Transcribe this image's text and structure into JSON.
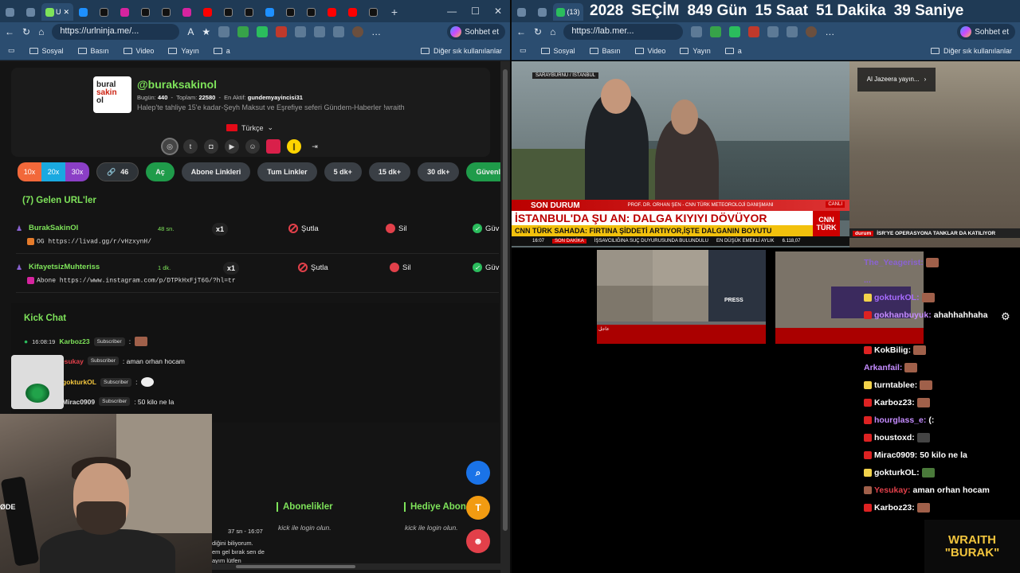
{
  "left_browser": {
    "active_tab": "U",
    "url": "https://urlninja.me/...",
    "sohbet": "Sohbet et",
    "bookmarks": [
      "Sosyal",
      "Basın",
      "Video",
      "Yayın",
      "a"
    ],
    "other_bookmarks": "Diğer sık kullanılanlar"
  },
  "profile": {
    "logo_lines": [
      "bural",
      "sakin",
      "ol"
    ],
    "username": "@buraksakinol",
    "today_label": "Bugün:",
    "today_value": "440",
    "total_label": "Toplam:",
    "total_value": "22580",
    "active_label": "En Aktif:",
    "active_value": "gundemyayincisi31",
    "description": "Halep'te tahliye 15'e kadar-Şeyh Maksut ve Eşrefiye seferi Gündem-Haberler !wraith",
    "language": "Türkçe"
  },
  "toolbar": {
    "speeds": [
      "10x",
      "20x",
      "30x"
    ],
    "link_count": "46",
    "ac": "Aç",
    "abone_links": "Abone Linkleri",
    "all_links": "Tum Linkler",
    "dk5": "5 dk+",
    "dk15": "15 dk+",
    "dk30": "30 dk+",
    "safe_open": "Güvenlileri Aç",
    "more": "G"
  },
  "incoming": {
    "title": "(7) Gelen URL'ler",
    "rows": [
      {
        "user": "BurakSakinOl",
        "time": "48 sn.",
        "link": "OG https://livad.gg/r/vHzxynH/",
        "count": "x1",
        "ban": "Şutla",
        "del": "Sil",
        "safe": "Güv"
      },
      {
        "user": "KifayetsizMuhteriss",
        "time": "1 dk.",
        "link": "Abone https://www.instagram.com/p/DTPkHxFjT6G/?hl=tr",
        "count": "x1",
        "ban": "Şutla",
        "del": "Sil",
        "safe": "Güv"
      }
    ]
  },
  "kick_chat": {
    "title": "Kick Chat",
    "lines": [
      {
        "time": "16:08:19",
        "user": "Karboz23",
        "badge": "Subscriber",
        "text": ":"
      },
      {
        "time": "",
        "user": "esukay",
        "badge": "Subscriber",
        "text": ": aman orhan hocam"
      },
      {
        "time": "",
        "user": "gokturkOL",
        "badge": "Subscriber",
        "text": ":"
      },
      {
        "time": "",
        "user": "Mirac0909",
        "badge": "Subscriber",
        "text": ": 50 kilo ne la"
      }
    ]
  },
  "webcam_label": "ØDE",
  "bottom": {
    "aboneler": "Abonelikler",
    "hediye": "Hediye Abon",
    "login1": "kick ile login olun.",
    "login2": "kick ile login olun.",
    "chat_time": "37 sn - 16:07",
    "chat_lines": [
      "diğini biliyorum.",
      "em gel bırak sen de",
      "ayım lütfen"
    ],
    "fab_t": "T"
  },
  "right_browser": {
    "tab_count": "(13)",
    "url": "https://lab.mer...",
    "sohbet": "Sohbet et",
    "bookmarks": [
      "Sosyal",
      "Basın",
      "Video",
      "Yayın",
      "a"
    ],
    "other_bookmarks": "Diğer sık kullanılanlar"
  },
  "countdown": {
    "year": "2028",
    "label": "SEÇİM",
    "days": "849 Gün",
    "hours": "15 Saat",
    "minutes": "51 Dakika",
    "seconds": "39 Saniye"
  },
  "cnn": {
    "location": "SARAYBURNU / İSTANBUL",
    "son_durum": "SON DURUM",
    "guest": "PROF. DR. ORHAN ŞEN - CNN TÜRK METEOROLOJİ DANIŞMANI",
    "live": "CANLI",
    "headline": "İSTANBUL'DA ŞU AN: DALGA KIYIYI DÖVÜYOR",
    "sub": "CNN TÜRK SAHADA: FIRTINA ŞİDDETİ ARTIYOR,İŞTE DALGANIN BOYUTU",
    "logo": [
      "CNN",
      "TÜRK"
    ],
    "ticker_time": "16:07",
    "ticker_tag": "SON DAKİKA",
    "ticker_text": "İŞSAVCILIĞINA SUÇ DUYURUSUNDA BULUNDULU",
    "ticker_right": "EN DÜŞÜK EMEKLİ AYLIK",
    "ticker_value": "6.118,07"
  },
  "aljazeera": {
    "button": "Al Jazeera yayın...",
    "bar_tag": "durum",
    "bar_text": "İSR'YE OPERASYONA TANKLAR DA KATILIYOR"
  },
  "mosaic": {
    "press": "PRESS",
    "cap": "عاجل"
  },
  "chat": [
    {
      "user": "The_Yeagerist:",
      "text": "",
      "color": "#8a63d2",
      "badge": ""
    },
    {
      "user": "...",
      "text": "",
      "color": "#8a63d2",
      "badge": ""
    },
    {
      "user": "gokturkOL:",
      "text": "",
      "color": "#a86cff",
      "badge": "#f2d24b"
    },
    {
      "user": "gokhanbuyuk:",
      "text": "ahahhahhaha",
      "color": "#ffffff",
      "badge": "#d22"
    },
    {
      "user": "KokBilig:",
      "text": "",
      "color": "#ffffff",
      "badge": "#d22"
    },
    {
      "user": "Arkanfail:",
      "text": "",
      "color": "#c58cff",
      "badge": ""
    },
    {
      "user": "turntablee:",
      "text": "",
      "color": "#ffffff",
      "badge": "#f2d24b"
    },
    {
      "user": "Karboz23:",
      "text": "",
      "color": "#ffffff",
      "badge": "#d22"
    },
    {
      "user": "hourglass_e:",
      "text": "(:",
      "color": "#c58cff",
      "badge": "#d22"
    },
    {
      "user": "houstoxd:",
      "text": "",
      "color": "#ffffff",
      "badge": "#d22"
    },
    {
      "user": "Mirac0909:",
      "text": "50 kilo ne la",
      "color": "#ffffff",
      "badge": "#d22"
    },
    {
      "user": "gokturkOL:",
      "text": "",
      "color": "#ffffff",
      "badge": "#f2d24b"
    },
    {
      "user": "Yesukay:",
      "text": "aman orhan hocam",
      "color": "#e2404a",
      "badge": "#a0604a"
    },
    {
      "user": "Karboz23:",
      "text": "",
      "color": "#ffffff",
      "badge": "#d22"
    }
  ],
  "wraith": [
    "WRAITH",
    "\"BURAK\""
  ]
}
